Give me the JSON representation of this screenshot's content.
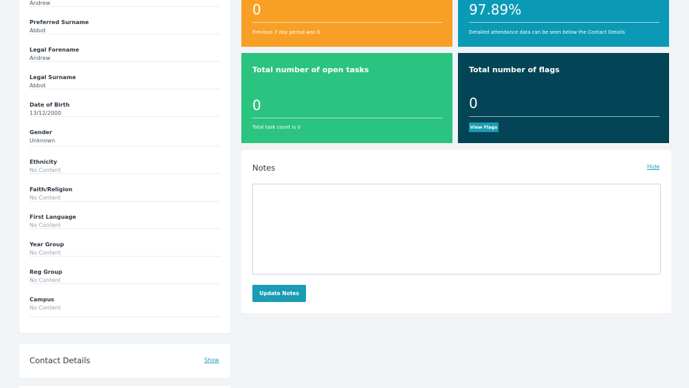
{
  "profile": {
    "fields": [
      {
        "label": "",
        "value": "Andrew"
      },
      {
        "label": "Preferred Surname",
        "value": "Abbot"
      },
      {
        "label": "Legal Forename",
        "value": "Andrew"
      },
      {
        "label": "Legal Surname",
        "value": "Abbot"
      },
      {
        "label": "Date of Birth",
        "value": "13/12/2000"
      },
      {
        "label": "Gender",
        "value": "Unknown"
      },
      {
        "label": "Ethnicity",
        "value": "No Content"
      },
      {
        "label": "Faith/Religion",
        "value": "No Content"
      },
      {
        "label": "First Language",
        "value": "No Content"
      },
      {
        "label": "Year Group",
        "value": "No Content"
      },
      {
        "label": "Reg Group",
        "value": "No Content"
      },
      {
        "label": "Campus",
        "value": "No Content"
      }
    ]
  },
  "contact_details": {
    "title": "Contact Details",
    "show_label": "Show"
  },
  "tiles": {
    "incidents": {
      "number": "0",
      "subtext": "Previous 7 day period was 0",
      "color": "#f8a026"
    },
    "attendance": {
      "number": "97.89%",
      "subtext": "Detailed attendance data can be seen below the Contact Details",
      "color": "#0b9ab6"
    },
    "tasks": {
      "title": "Total number of open tasks",
      "number": "0",
      "subtext": "Total task count is 0",
      "color": "#2bc380"
    },
    "flags": {
      "title": "Total number of flags",
      "number": "0",
      "button_label": "View Flags",
      "color": "#034456"
    }
  },
  "notes": {
    "title": "Notes",
    "hide_label": "Hide",
    "value": "",
    "update_label": "Update Notes"
  }
}
